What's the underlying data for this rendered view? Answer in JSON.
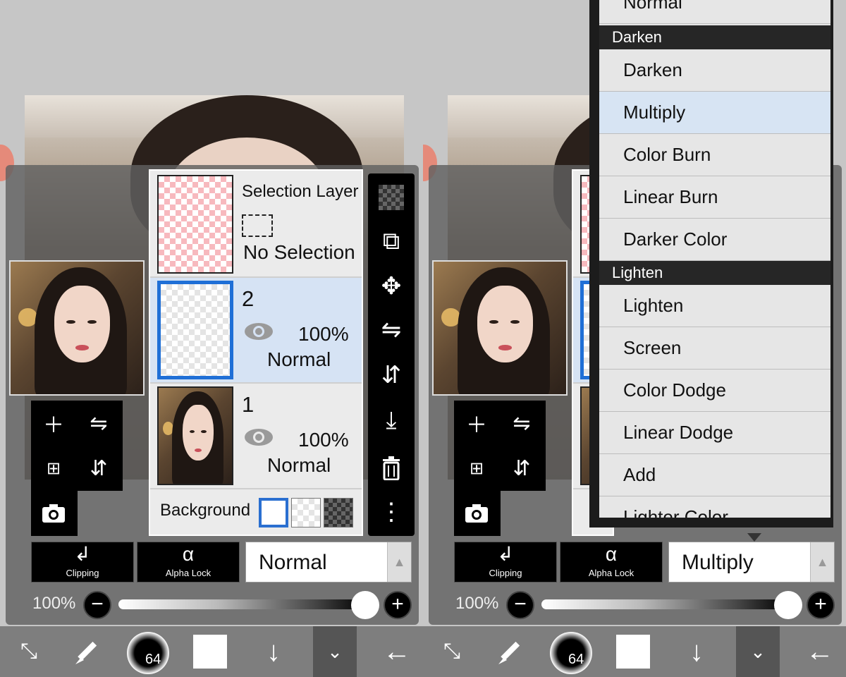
{
  "layers": {
    "selection": {
      "name": "Selection Layer",
      "state": "No Selection"
    },
    "layer2": {
      "name": "2",
      "opacity": "100%",
      "blend": "Normal"
    },
    "layer1": {
      "name": "1",
      "opacity": "100%",
      "blend": "Normal"
    },
    "background_label": "Background"
  },
  "controls_left": {
    "clipping": "Clipping",
    "alpha_lock": "Alpha Lock",
    "alpha_lock_icon": "α",
    "blend_mode": "Normal"
  },
  "controls_right": {
    "clipping": "Clipping",
    "alpha_lock": "Alpha Lock",
    "alpha_lock_icon": "α",
    "blend_mode": "Multiply"
  },
  "opacity": {
    "label": "100%",
    "value": 1.0
  },
  "brush": {
    "size": "64"
  },
  "icons": {
    "checker": "checkerboard-icon",
    "transfer": "layer-transfer-icon",
    "move": "move-icon",
    "flip_h": "flip-horizontal-icon",
    "flip_v": "flip-vertical-icon",
    "merge_down": "merge-down-icon",
    "trash": "trash-icon",
    "more": "more-vertical-icon",
    "add": "add-layer-icon",
    "duplicate": "duplicate-layer-icon",
    "camera": "camera-icon",
    "eye": "eye-icon"
  },
  "dropdown": {
    "top_item": "Normal",
    "groups": [
      {
        "header": "Darken",
        "items": [
          "Darken",
          "Multiply",
          "Color Burn",
          "Linear Burn",
          "Darker Color"
        ]
      },
      {
        "header": "Lighten",
        "items": [
          "Lighten",
          "Screen",
          "Color Dodge",
          "Linear Dodge",
          "Add",
          "Lighter Color"
        ]
      }
    ],
    "selected": "Multiply"
  }
}
